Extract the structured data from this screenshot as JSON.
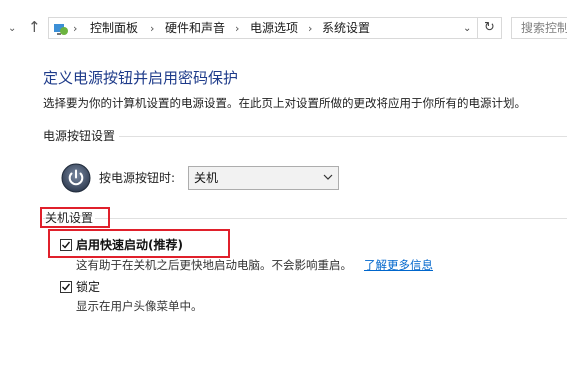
{
  "breadcrumb": [
    "控制面板",
    "硬件和声音",
    "电源选项",
    "系统设置"
  ],
  "search": {
    "placeholder": "搜索控制"
  },
  "page": {
    "title": "定义电源按钮并启用密码保护",
    "description": "选择要为你的计算机设置的电源设置。在此页上对设置所做的更改将应用于你所有的电源计划。"
  },
  "power_button_section": {
    "heading": "电源按钮设置",
    "label": "按电源按钮时:",
    "selected": "关机"
  },
  "shutdown_section": {
    "heading": "关机设置",
    "fast_startup": {
      "label": "启用快速启动(推荐)",
      "checked": true,
      "note": "这有助于在关机之后更快地启动电脑。不会影响重启。",
      "link": "了解更多信息"
    },
    "lock": {
      "label": "锁定",
      "checked": true,
      "note": "显示在用户头像菜单中。"
    }
  },
  "colors": {
    "accent_title": "#1e3b8a",
    "highlight": "#e0202b",
    "link": "#0066cc"
  }
}
